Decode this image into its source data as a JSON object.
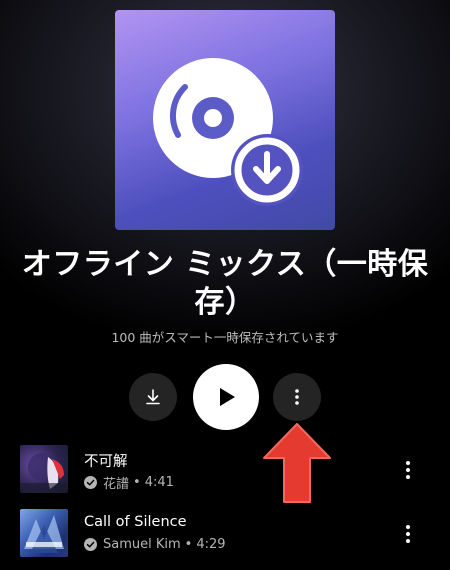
{
  "playlist": {
    "title": "オフライン ミックス（一時保存）",
    "subtitle": "100 曲がスマート一時保存されています"
  },
  "actions": {
    "download_icon": "download-icon",
    "play_icon": "play-icon",
    "more_icon": "more-vert-icon"
  },
  "annotation": {
    "arrow_color": "#e53a2f",
    "arrow_icon": "red-arrow-up-icon"
  },
  "tracks": [
    {
      "title": "不可解",
      "artist": "花譜",
      "duration": "4:41",
      "separator": "•"
    },
    {
      "title": "Call of Silence",
      "artist": "Samuel Kim",
      "duration": "4:29",
      "separator": "•"
    }
  ],
  "colors": {
    "background": "#000000",
    "cover_gradient_start": "#b294f2",
    "cover_gradient_end": "#414aa6"
  }
}
